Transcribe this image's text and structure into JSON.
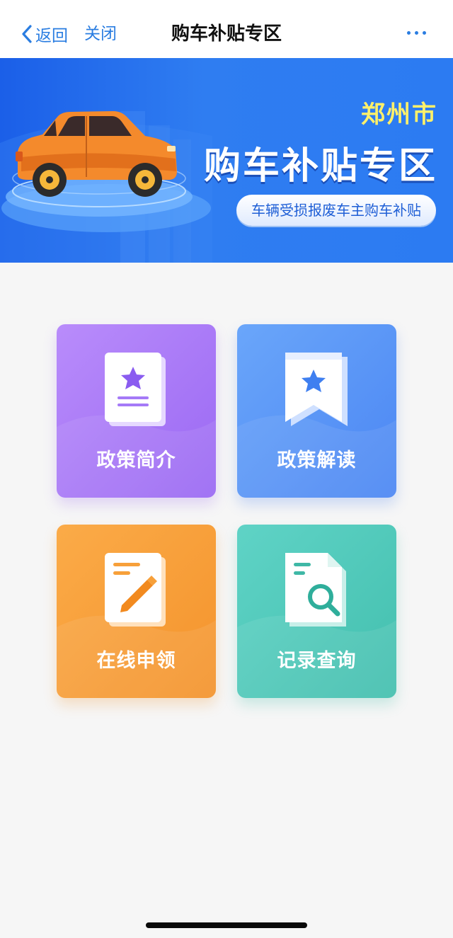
{
  "nav": {
    "back_label": "返回",
    "close_label": "关闭",
    "title": "购车补贴专区"
  },
  "banner": {
    "city": "郑州市",
    "title": "购车补贴专区",
    "subtitle": "车辆受损报废车主购车补贴"
  },
  "tiles": [
    {
      "label": "政策简介",
      "icon": "document-star-icon",
      "color": "#a57af7"
    },
    {
      "label": "政策解读",
      "icon": "bookmark-star-icon",
      "color": "#5794f6"
    },
    {
      "label": "在线申领",
      "icon": "edit-document-icon",
      "color": "#f7a03a"
    },
    {
      "label": "记录查询",
      "icon": "search-document-icon",
      "color": "#4fc8b9"
    }
  ]
}
